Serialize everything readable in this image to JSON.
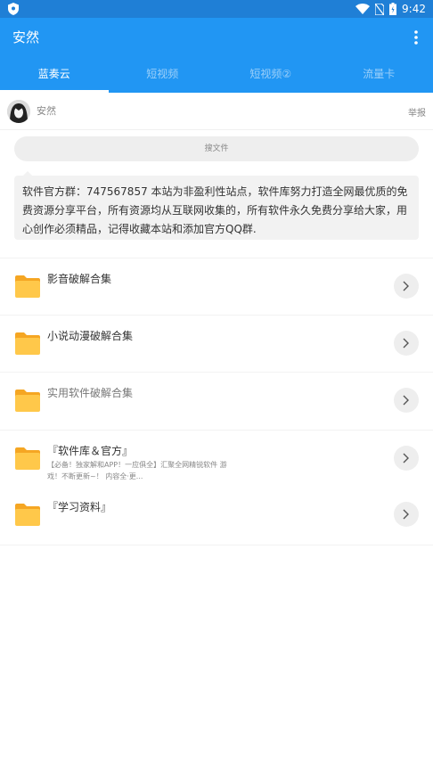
{
  "status_bar": {
    "time": "9:42"
  },
  "appbar": {
    "title": "安然",
    "menu_icon": "more-vert-icon"
  },
  "tabs": [
    {
      "label": "蓝奏云",
      "active": true
    },
    {
      "label": "短视频",
      "active": false
    },
    {
      "label": "短视频②",
      "active": false
    },
    {
      "label": "流量卡",
      "active": false
    }
  ],
  "user": {
    "name": "安然",
    "report_label": "举报"
  },
  "search": {
    "placeholder": "搜文件"
  },
  "notice": {
    "text": "软件官方群：747567857 本站为非盈利性站点，软件库努力打造全网最优质的免费资源分享平台，所有资源均从互联网收集的，所有软件永久免费分享给大家，用心创作必须精品，记得收藏本站和添加官方QQ群."
  },
  "folders": [
    {
      "name": "影音破解合集",
      "desc": ""
    },
    {
      "name": "小说动漫破解合集",
      "desc": ""
    },
    {
      "name": "实用软件破解合集",
      "desc": ""
    },
    {
      "name": "『软件库＆官方』",
      "desc": "【必备！独家解和APP！一应俱全】汇聚全网精锐软件 游戏！不断更新~！ 内容全·更..."
    },
    {
      "name": "『学习资料』",
      "desc": ""
    }
  ],
  "colors": {
    "primary": "#2196f3",
    "status_bar": "#1f7fd6",
    "folder": "#ffc84a"
  }
}
